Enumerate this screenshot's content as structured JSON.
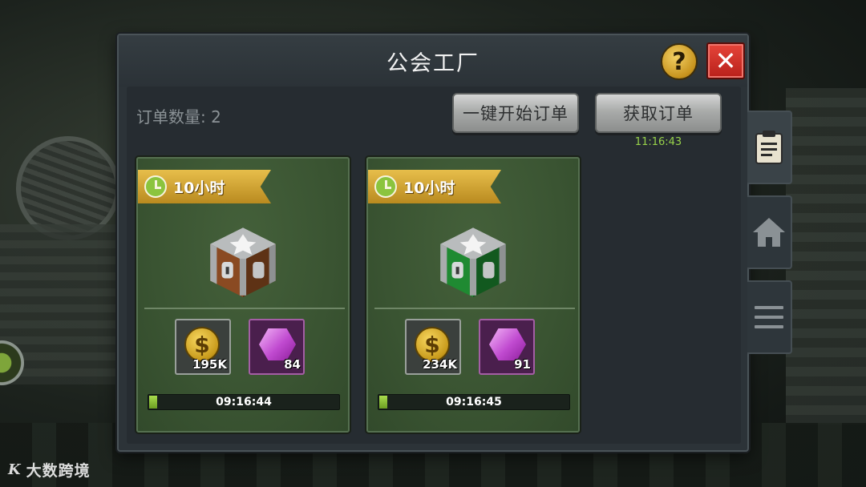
{
  "panel": {
    "title": "公会工厂",
    "help_label": "?",
    "close_label": "✕"
  },
  "toolbar": {
    "order_count_label": "订单数量: 2",
    "start_all_label": "一键开始订单",
    "fetch_label": "获取订单",
    "fetch_timer": "11:16:43"
  },
  "orders": [
    {
      "duration": "10小时",
      "chest_color": "#8a4a22",
      "gold_amount": "195K",
      "gem_amount": "84",
      "timer": "09:16:44",
      "progress": 0.03
    },
    {
      "duration": "10小时",
      "chest_color": "#1f8a32",
      "gold_amount": "234K",
      "gem_amount": "91",
      "timer": "09:16:45",
      "progress": 0.03
    }
  ],
  "side_tabs": [
    {
      "icon": "clipboard-icon",
      "active": true
    },
    {
      "icon": "home-icon",
      "active": false
    },
    {
      "icon": "menu-icon",
      "active": false
    }
  ],
  "watermark": {
    "logo": "K",
    "text": "大数跨境"
  },
  "colors": {
    "accent_green": "#98d34a",
    "ribbon_gold": "#e7be4b",
    "close_red": "#e6453a"
  }
}
